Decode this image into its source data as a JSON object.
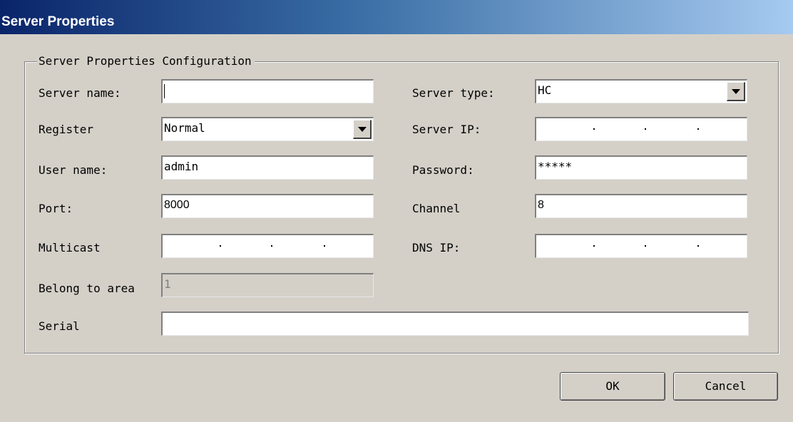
{
  "window": {
    "title": "Server Properties"
  },
  "group": {
    "legend": "Server Properties Configuration"
  },
  "labels": {
    "server_name": "Server name:",
    "register": "Register",
    "user_name": "User name:",
    "port": "Port:",
    "multicast": "Multicast",
    "belong_to_area": "Belong to area",
    "serial": "Serial",
    "server_type": "Server type:",
    "server_ip": "Server IP:",
    "password": "Password:",
    "channel": "Channel",
    "dns_ip": "DNS IP:"
  },
  "values": {
    "server_name": "",
    "register": "Normal",
    "user_name": "admin",
    "port": "8000",
    "multicast": "",
    "belong_to_area": "1",
    "serial": "",
    "server_type": "HC",
    "server_ip": "",
    "password": "*****",
    "channel": "8",
    "dns_ip": ""
  },
  "buttons": {
    "ok": "OK",
    "cancel": "Cancel"
  },
  "icons": {
    "dropdown": "chevron-down-icon"
  }
}
